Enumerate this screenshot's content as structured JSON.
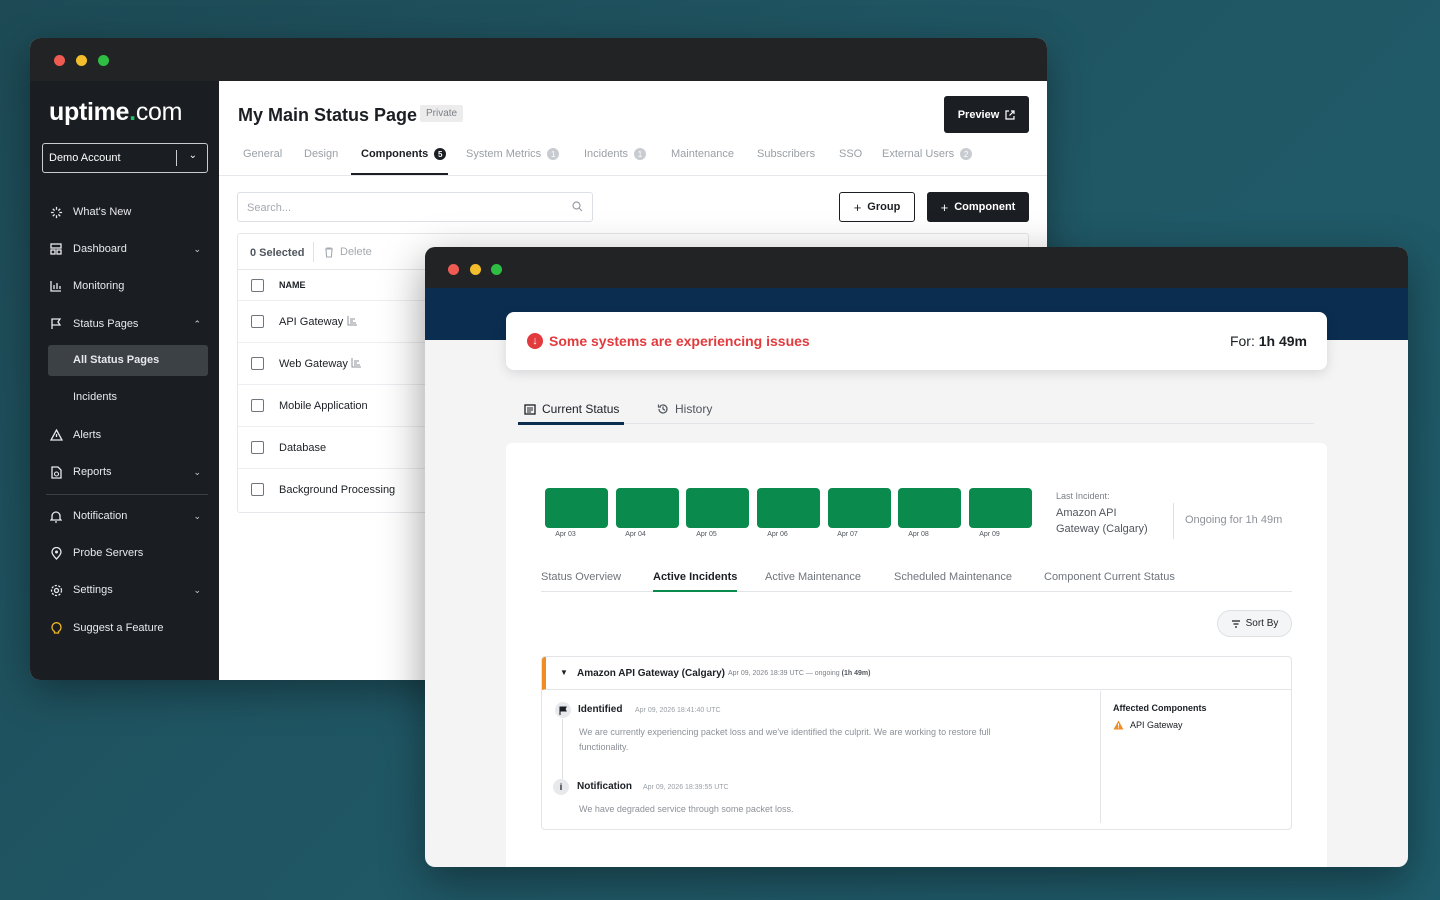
{
  "back_window": {
    "logo": {
      "main": "uptime",
      "dot": ".",
      "suffix": "com"
    },
    "account_select": "Demo Account",
    "sidebar": {
      "items": [
        {
          "label": "What's New",
          "icon": "sparkle-icon"
        },
        {
          "label": "Dashboard",
          "icon": "dashboard-icon"
        },
        {
          "label": "Monitoring",
          "icon": "bar-chart-icon"
        },
        {
          "label": "Status Pages",
          "icon": "flag-icon"
        },
        {
          "label": "All Status Pages"
        },
        {
          "label": "Incidents"
        },
        {
          "label": "Alerts",
          "icon": "warning-triangle-icon"
        },
        {
          "label": "Reports",
          "icon": "report-icon"
        },
        {
          "label": "Notification",
          "icon": "bell-icon"
        },
        {
          "label": "Probe Servers",
          "icon": "location-pin-icon"
        },
        {
          "label": "Settings",
          "icon": "gear-icon"
        },
        {
          "label": "Suggest a Feature",
          "icon": "lightbulb-icon"
        }
      ]
    },
    "header": {
      "title": "My Main Status Page",
      "badge": "Private",
      "preview_label": "Preview"
    },
    "tabs": [
      {
        "label": "General"
      },
      {
        "label": "Design"
      },
      {
        "label": "Components",
        "count": "5"
      },
      {
        "label": "System Metrics",
        "count": "1"
      },
      {
        "label": "Incidents",
        "count": "1"
      },
      {
        "label": "Maintenance"
      },
      {
        "label": "Subscribers"
      },
      {
        "label": "SSO"
      },
      {
        "label": "External Users",
        "count": "2"
      }
    ],
    "search_placeholder": "Search...",
    "group_label": "Group",
    "component_label": "Component",
    "table": {
      "selected": "0 Selected",
      "delete": "Delete",
      "column_name": "NAME",
      "rows": [
        "API Gateway",
        "Web Gateway",
        "Mobile Application",
        "Database",
        "Background Processing"
      ]
    }
  },
  "front_window": {
    "alert": {
      "message": "Some systems are experiencing issues",
      "for_label": "For:",
      "for_value": "1h 49m",
      "status_color": "#e23a3d"
    },
    "tabs": [
      {
        "label": "Current Status",
        "icon": "newspaper-icon"
      },
      {
        "label": "History",
        "icon": "history-icon"
      }
    ],
    "uptime_days": [
      "Apr 03",
      "Apr 04",
      "Apr 05",
      "Apr 06",
      "Apr 07",
      "Apr 08",
      "Apr 09"
    ],
    "uptime_color": "#0a8a4c",
    "last_incident": {
      "label": "Last Incident:",
      "name": "Amazon API Gateway (Calgary)",
      "ongoing": "Ongoing for 1h 49m"
    },
    "sub_tabs": [
      "Status Overview",
      "Active Incidents",
      "Active Maintenance",
      "Scheduled Maintenance",
      "Component Current Status"
    ],
    "sort_label": "Sort By",
    "incident": {
      "title": "Amazon API Gateway (Calgary)",
      "meta": "Apr 09, 2026 18:39 UTC — ongoing",
      "duration": "(1h 49m)",
      "updates": [
        {
          "status": "Identified",
          "time": "Apr 09, 2026 18:41:40 UTC",
          "body": "We are currently experiencing packet loss and we've identified the culprit. We are working to restore full functionality."
        },
        {
          "status": "Notification",
          "time": "Apr 09, 2026 18:39:55 UTC",
          "body": "We have degraded service through some packet loss."
        }
      ],
      "affected_title": "Affected Components",
      "affected": [
        "API Gateway"
      ]
    }
  }
}
